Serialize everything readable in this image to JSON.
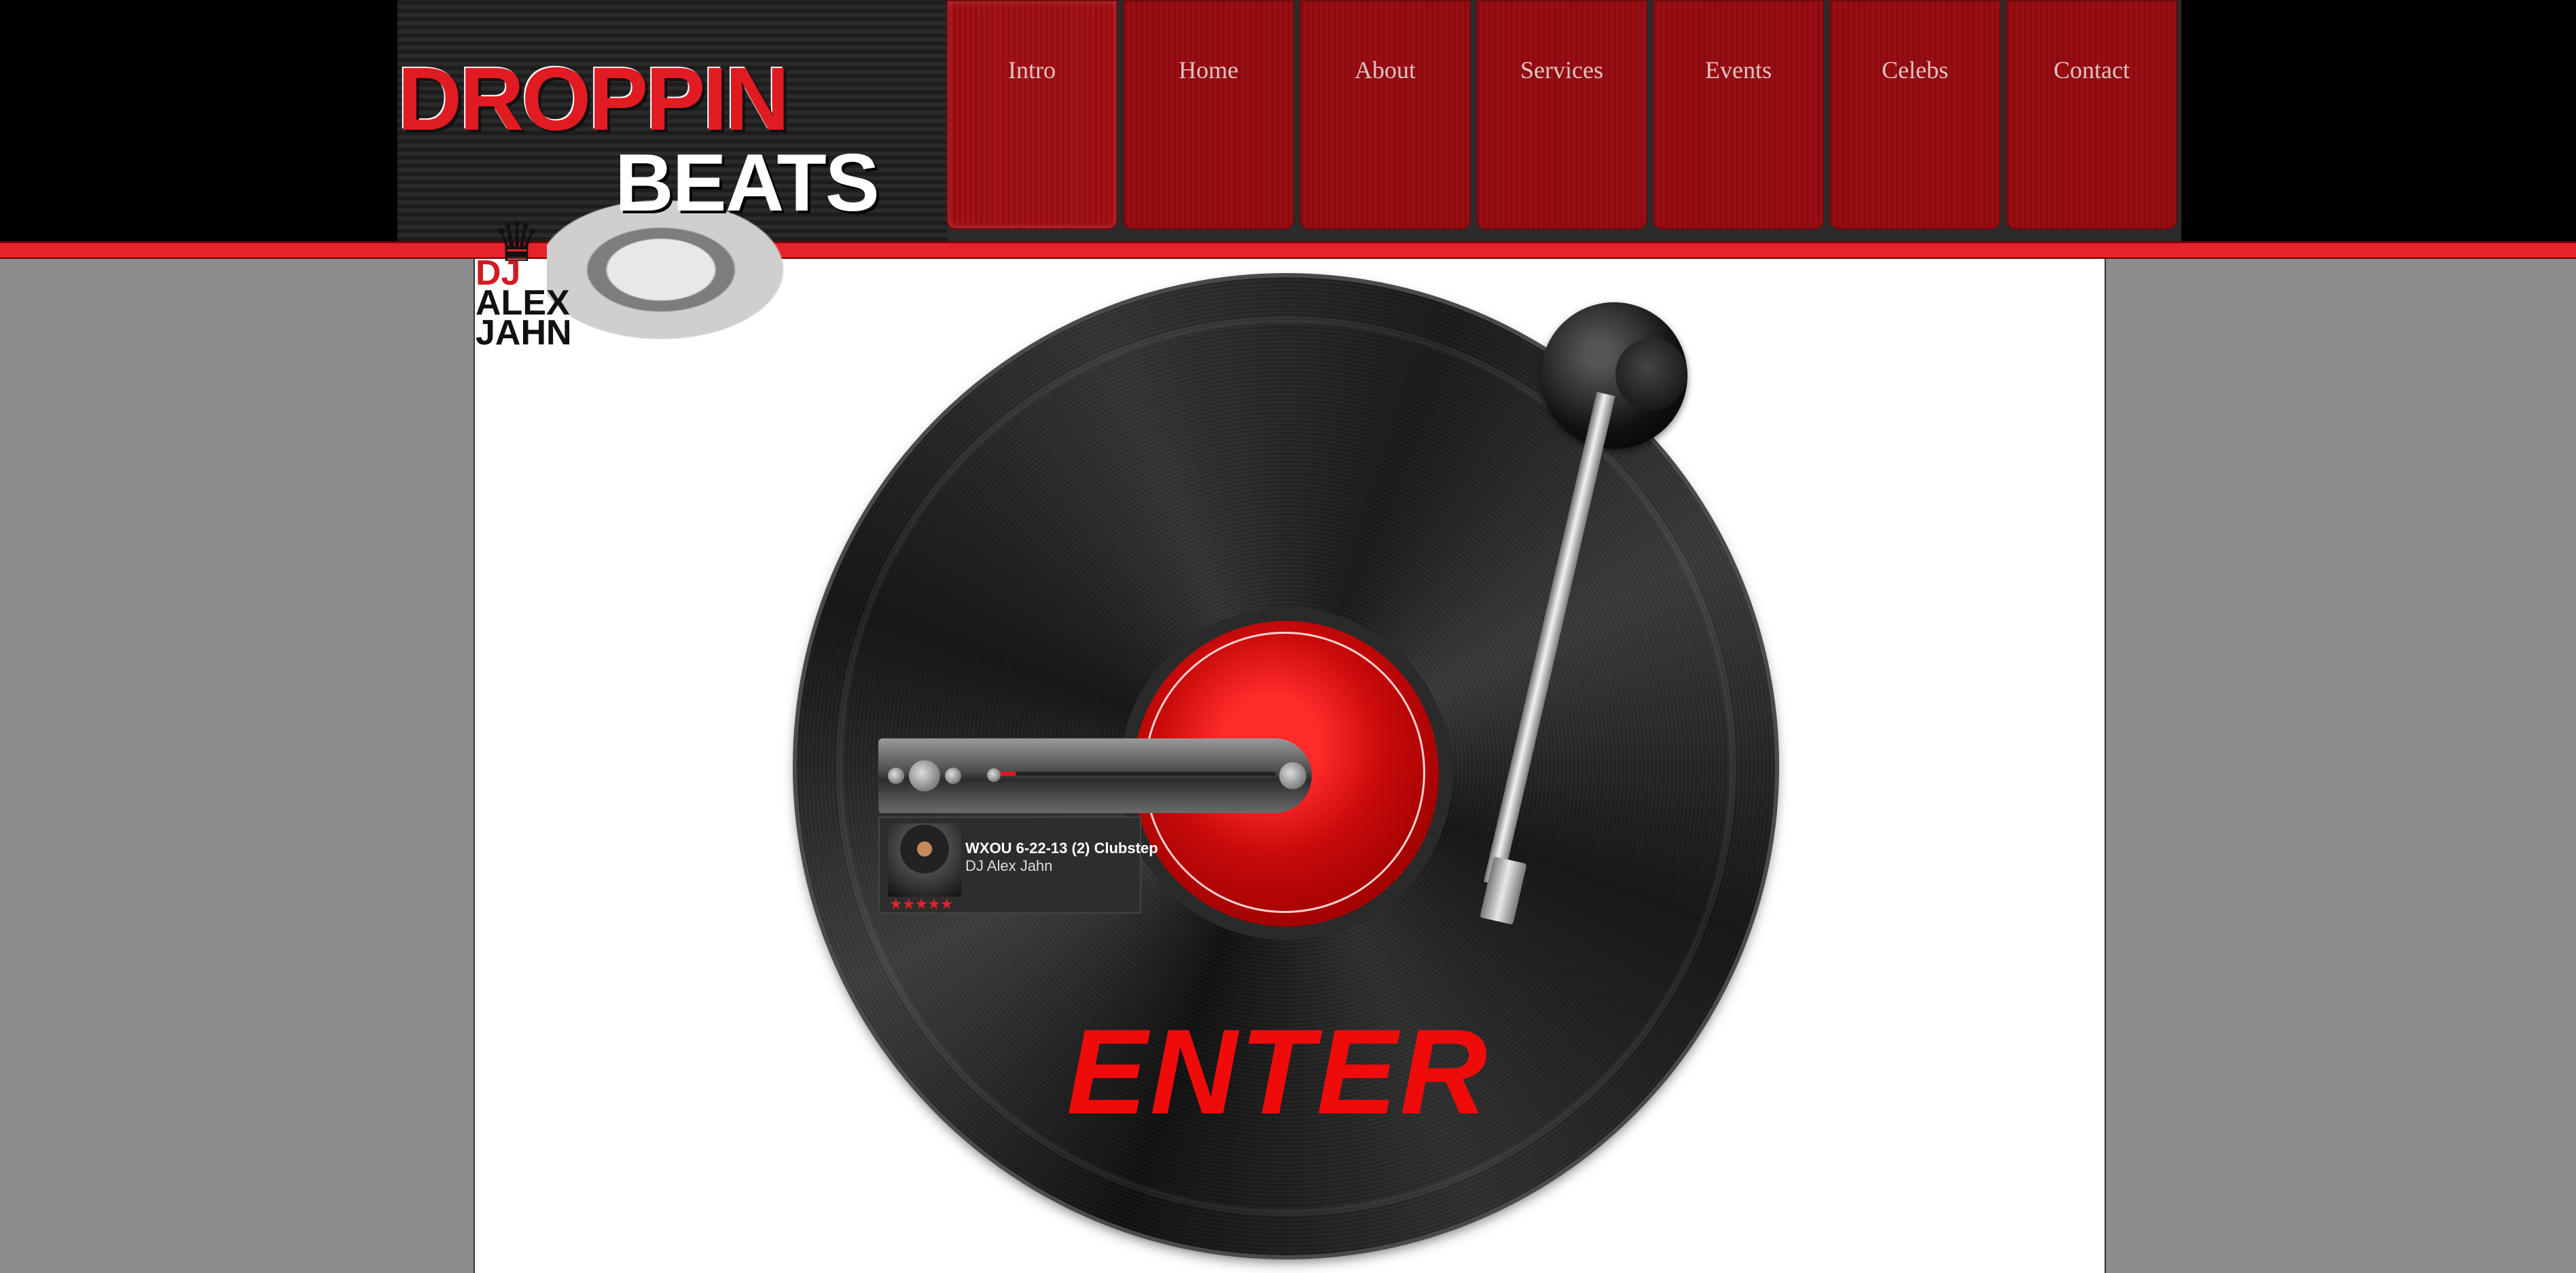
{
  "nav": {
    "items": [
      {
        "label": "Intro"
      },
      {
        "label": "Home"
      },
      {
        "label": "About"
      },
      {
        "label": "Services"
      },
      {
        "label": "Events"
      },
      {
        "label": "Celebs"
      },
      {
        "label": "Contact"
      }
    ]
  },
  "logo": {
    "line1": "DROPPIN",
    "line2": "BEATS",
    "dj": "DJ",
    "name_first": "ALEX",
    "name_last": "JAHN"
  },
  "player": {
    "track_title": "WXOU 6-22-13 (2) Clubstep",
    "artist": "DJ Alex Jahn",
    "stars": "★★★★★",
    "progress_fraction": 0.08
  },
  "enter_label": "ENTER",
  "colors": {
    "accent_red": "#e8222c",
    "nav_red": "#8c0b10",
    "page_gray": "#8c8c8c"
  }
}
